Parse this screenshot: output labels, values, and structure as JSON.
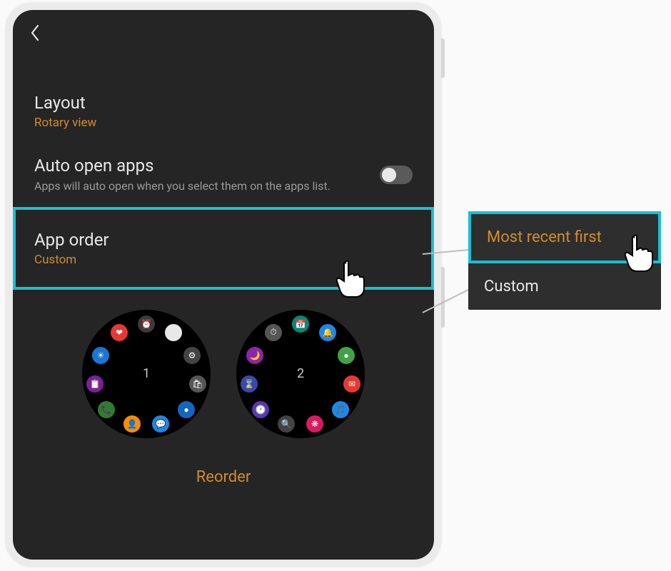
{
  "settings": {
    "layout": {
      "title": "Layout",
      "value": "Rotary view"
    },
    "auto_open": {
      "title": "Auto open apps",
      "desc": "Apps will auto open when you select them on the apps list.",
      "enabled": false
    },
    "app_order": {
      "title": "App order",
      "value": "Custom"
    },
    "reorder_label": "Reorder"
  },
  "watch_pages": [
    {
      "label": "1"
    },
    {
      "label": "2"
    }
  ],
  "popup": {
    "options": [
      {
        "label": "Most recent first",
        "selected": true
      },
      {
        "label": "Custom",
        "selected": false
      }
    ]
  },
  "colors": {
    "accent": "#d28b2d",
    "highlight": "#17c0d4"
  }
}
